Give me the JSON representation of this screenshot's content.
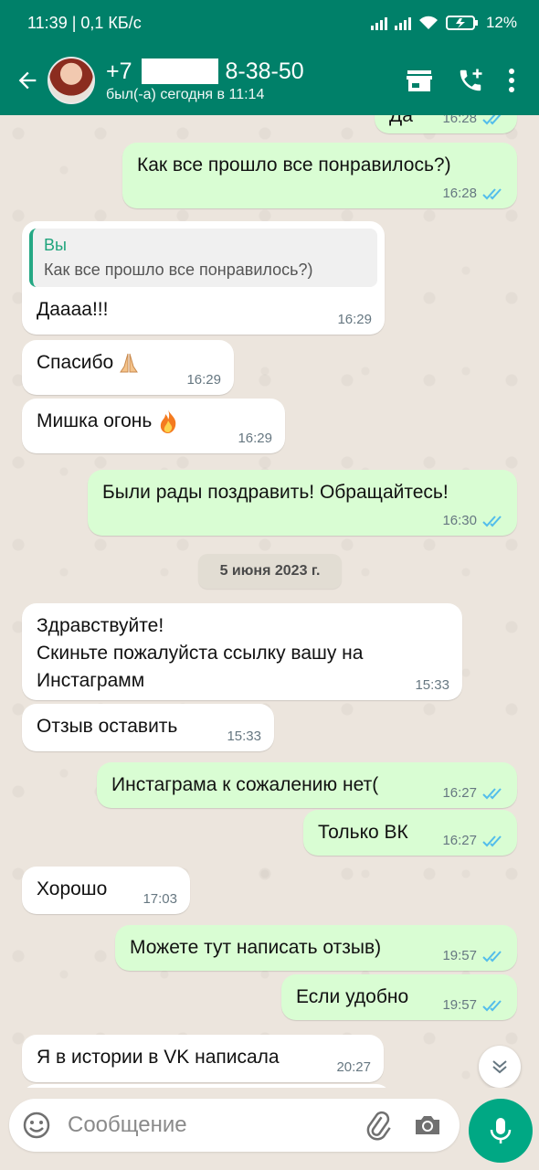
{
  "status_bar": {
    "time_speed": "11:39 | 0,1 КБ/с",
    "battery": "12%"
  },
  "header": {
    "contact_prefix": "+7",
    "contact_suffix": "8-38-50",
    "last_seen": "был(-а) сегодня в 11:14",
    "accent_color": "#008069"
  },
  "messages": [
    {
      "dir": "out",
      "text": "Да",
      "time": "16:28"
    },
    {
      "dir": "out",
      "text": "Как все прошло все понравилось?)",
      "time": "16:28"
    },
    {
      "dir": "in",
      "quote_author": "Вы",
      "quote_text": "Как все прошло все понравилось?)",
      "text": "Даааа!!!",
      "time": "16:29"
    },
    {
      "dir": "in",
      "text": "Спасибо",
      "emoji": "folded-hands",
      "time": "16:29"
    },
    {
      "dir": "in",
      "text": "Мишка огонь",
      "emoji": "fire",
      "time": "16:29"
    },
    {
      "dir": "out",
      "text": "Были рады поздравить! Обращайтесь!",
      "time": "16:30"
    },
    {
      "dir": "in",
      "text": "Здравствуйте!\nСкиньте пожалуйста ссылку вашу на Инстаграмм",
      "time": "15:33"
    },
    {
      "dir": "in",
      "text": "Отзыв оставить",
      "time": "15:33"
    },
    {
      "dir": "out",
      "text": "Инстаграма к сожалению нет(",
      "time": "16:27"
    },
    {
      "dir": "out",
      "text": "Только ВК",
      "time": "16:27"
    },
    {
      "dir": "in",
      "text": "Хорошо",
      "time": "17:03"
    },
    {
      "dir": "out",
      "text": "Можете тут написать отзыв)",
      "time": "19:57"
    },
    {
      "dir": "out",
      "text": "Если удобно",
      "time": "19:57"
    },
    {
      "dir": "in",
      "text": "Я в истории в VK написала",
      "time": "20:27"
    }
  ],
  "date_chip": "5 июня 2023 г.",
  "composer": {
    "placeholder": "Сообщение"
  },
  "colors": {
    "outgoing_bubble": "#d9fdd3",
    "incoming_bubble": "#ffffff",
    "read_ticks": "#53bdeb",
    "mic_button": "#00a884"
  }
}
